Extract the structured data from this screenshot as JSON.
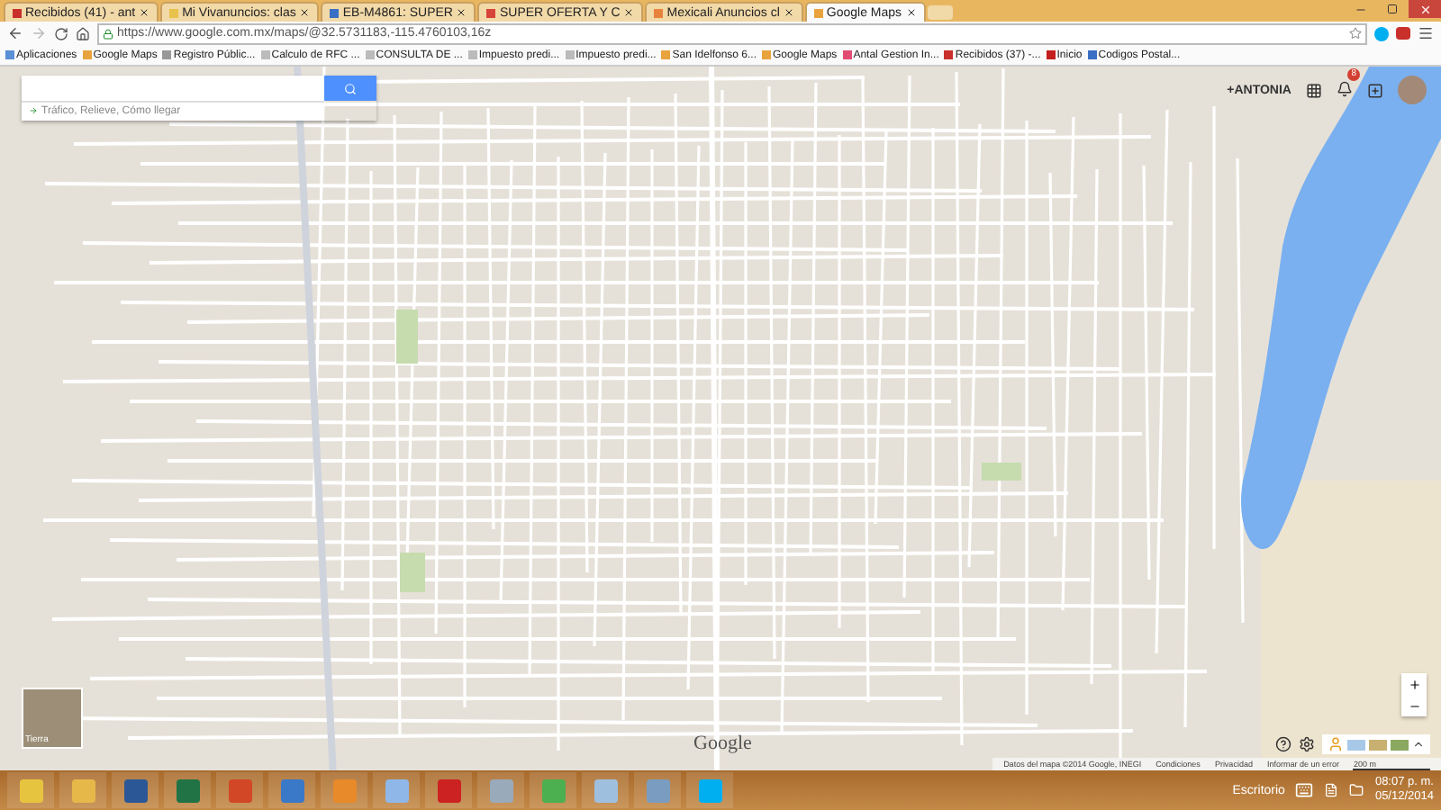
{
  "browser": {
    "tabs": [
      {
        "label": "Recibidos (41) - ant",
        "selected": false
      },
      {
        "label": "Mi Vivanuncios: clas",
        "selected": false
      },
      {
        "label": "EB-M4861: SUPER",
        "selected": false
      },
      {
        "label": "SUPER OFERTA Y C",
        "selected": false
      },
      {
        "label": "Mexicali Anuncios cl",
        "selected": false
      },
      {
        "label": "Google Maps",
        "selected": true
      }
    ],
    "address": "https://www.google.com.mx/maps/@32.5731183,-115.4760103,16z",
    "bookmarks": [
      "Aplicaciones",
      "Google Maps",
      "Registro Públic...",
      "Calculo de RFC ...",
      "CONSULTA DE ...",
      "Impuesto predi...",
      "Impuesto predi...",
      "San Idelfonso 6...",
      "Google Maps",
      "Antal Gestion In...",
      "Recibidos (37) -...",
      "Inicio",
      "Codigos Postal..."
    ]
  },
  "map": {
    "layers_hint": "Tráfico, Relieve, Cómo llegar",
    "account": "+ANTONIA",
    "notifications": "8",
    "thumbnail_label": "Tierra",
    "logo": "Google",
    "footer": [
      "Datos del mapa ©2014 Google, INEGI",
      "Condiciones",
      "Privacidad",
      "Informar de un error",
      "200 m"
    ]
  },
  "taskbar": {
    "desktop_label": "Escritorio",
    "time": "08:07 p. m.",
    "date": "05/12/2014"
  }
}
